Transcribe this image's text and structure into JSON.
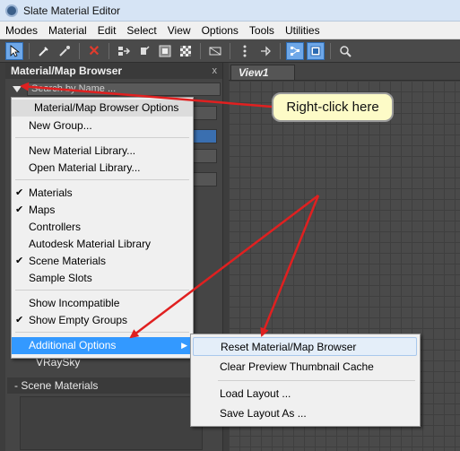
{
  "window": {
    "title": "Slate Material Editor"
  },
  "menubar": {
    "items": [
      "Modes",
      "Material",
      "Edit",
      "Select",
      "View",
      "Options",
      "Tools",
      "Utilities"
    ]
  },
  "toolbar": {
    "icons": [
      "select-pointer-icon",
      "eyedropper-icon",
      "pick-material-icon",
      "delete-icon",
      "move-children-icon",
      "layout-icon",
      "show-background-icon",
      "checker-icon",
      "sample-box-icon",
      "show-shaded-icon",
      "hide-icon",
      "node-layout-icon",
      "active-view-icon",
      "magnify-icon"
    ]
  },
  "panel": {
    "title": "Material/Map Browser",
    "close": "x",
    "search_placeholder": "Search by Name ...",
    "vraysky": "VRaySky",
    "scene_materials": "- Scene Materials"
  },
  "view": {
    "tab_label": "View1"
  },
  "context_menu": {
    "header": "Material/Map Browser Options",
    "new_group": "New Group...",
    "new_library": "New Material Library...",
    "open_library": "Open Material Library...",
    "materials": "Materials",
    "maps": "Maps",
    "controllers": "Controllers",
    "autodesk_library": "Autodesk Material Library",
    "scene_materials": "Scene Materials",
    "sample_slots": "Sample Slots",
    "show_incompatible": "Show Incompatible",
    "show_empty_groups": "Show Empty Groups",
    "additional_options": "Additional Options",
    "check": "✔",
    "submenu_arrow": "▶"
  },
  "submenu": {
    "reset": "Reset Material/Map Browser",
    "clear_cache": "Clear Preview Thumbnail Cache",
    "load_layout": "Load Layout ...",
    "save_layout": "Save Layout As ..."
  },
  "annotation": {
    "callout": "Right-click here",
    "arrow_color": "#e02020"
  },
  "colors": {
    "highlight": "#3399ff",
    "callout_bg": "#fdfbc7"
  }
}
